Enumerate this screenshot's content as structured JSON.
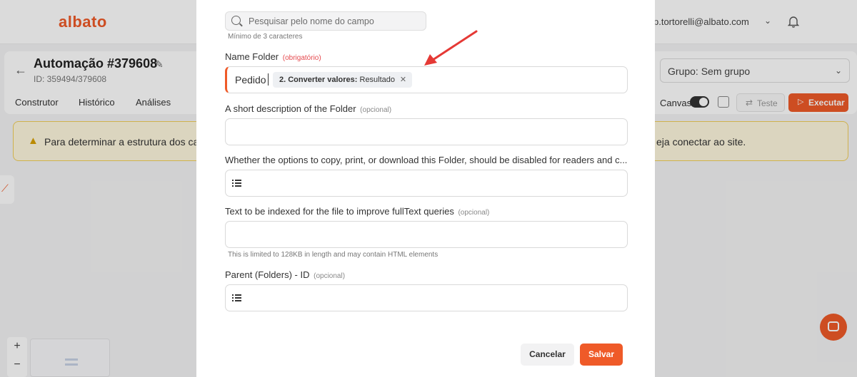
{
  "app": {
    "logo": "albato",
    "user_email": "p.tortorelli@albato.com"
  },
  "automation": {
    "title": "Automação #379608",
    "id_text": "ID: 359494/379608",
    "group_select": "Grupo: Sem grupo"
  },
  "tabs": [
    "Construtor",
    "Histórico",
    "Análises"
  ],
  "toolbar": {
    "canvas_label": "Canvas",
    "canvas_on": true,
    "test_label": "Teste",
    "execute_label": "Executar"
  },
  "warning": {
    "text_left": "Para determinar a estrutura dos camp",
    "text_right": "eja conectar ao site."
  },
  "modal": {
    "search": {
      "placeholder": "Pesquisar pelo nome do campo",
      "hint": "Mínimo de 3 caracteres"
    },
    "fields": [
      {
        "label": "Name Folder",
        "tag": "(obrigatório)",
        "required": true,
        "value_text": "Pedido",
        "chip_bold": "2. Converter valores:",
        "chip_text": "Resultado"
      },
      {
        "label": "A short description of the Folder",
        "tag": "(opcional)"
      },
      {
        "label": "Whether the options to copy, print, or download this Folder, should be disabled for readers and c...",
        "tag": ""
      },
      {
        "label": "Text to be indexed for the file to improve fullText queries",
        "tag": "(opcional)",
        "hint": "This is limited to 128KB in length and may contain HTML elements"
      },
      {
        "label": "Parent (Folders) - ID",
        "tag": "(opcional)"
      }
    ],
    "cancel_label": "Cancelar",
    "save_label": "Salvar"
  },
  "colors": {
    "accent": "#ef5a28",
    "required": "#e5484d",
    "warning_bg": "#fff8df",
    "warning_border": "#f2cf5a"
  }
}
